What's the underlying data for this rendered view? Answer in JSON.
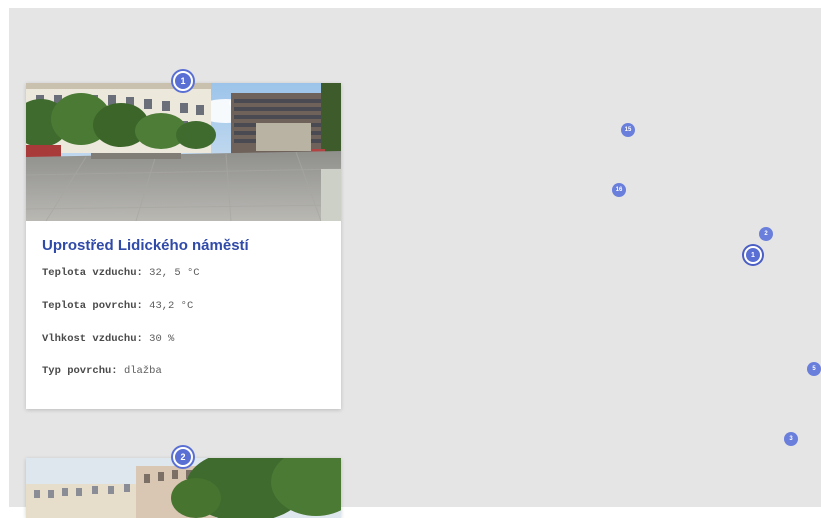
{
  "cards": [
    {
      "marker": "1",
      "title": "Uprostřed Lidického náměstí",
      "stats": [
        {
          "label": "Teplota vzduchu:",
          "value": "32, 5 °C"
        },
        {
          "label": "Teplota povrchu:",
          "value": "43,2 °C"
        },
        {
          "label": "Vlhkost vzduchu:",
          "value": "30 %"
        },
        {
          "label": "Typ povrchu:",
          "value": "dlažba"
        }
      ]
    },
    {
      "marker": "2"
    }
  ],
  "map_markers": [
    "15",
    "16",
    "2",
    "1",
    "5",
    "3"
  ],
  "colors": {
    "marker": "#5a6fd3",
    "title": "#2f4aa8",
    "map_background": "#e5e5e5"
  }
}
